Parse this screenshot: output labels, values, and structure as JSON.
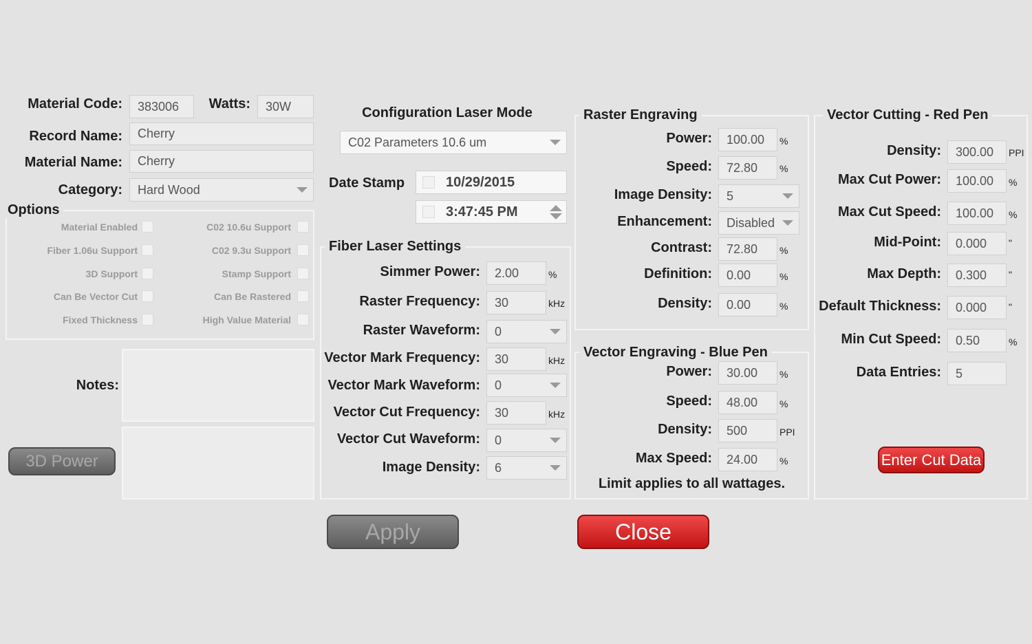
{
  "material": {
    "code_label": "Material Code:",
    "code_value": "383006",
    "watts_label": "Watts:",
    "watts_value": "30W",
    "record_label": "Record Name:",
    "record_value": "Cherry",
    "name_label": "Material Name:",
    "name_value": "Cherry",
    "category_label": "Category:",
    "category_value": "Hard Wood"
  },
  "options": {
    "title": "Options",
    "left": [
      {
        "label": "Material Enabled",
        "checked": false
      },
      {
        "label": "Fiber 1.06u Support",
        "checked": false
      },
      {
        "label": "3D Support",
        "checked": false
      },
      {
        "label": "Can Be Vector Cut",
        "checked": false
      },
      {
        "label": "Fixed Thickness",
        "checked": false
      }
    ],
    "right": [
      {
        "label": "C02 10.6u Support",
        "checked": false
      },
      {
        "label": "C02 9.3u Support",
        "checked": false
      },
      {
        "label": "Stamp Support",
        "checked": false
      },
      {
        "label": "Can Be Rastered",
        "checked": false
      },
      {
        "label": "High Value Material",
        "checked": false
      }
    ]
  },
  "notes": {
    "label": "Notes:"
  },
  "buttons": {
    "power3d": "3D Power",
    "apply": "Apply",
    "close": "Close",
    "enter_cut": "Enter Cut Data"
  },
  "config": {
    "title": "Configuration Laser Mode",
    "mode_value": "C02 Parameters 10.6 um",
    "date_stamp_label": "Date Stamp",
    "date_value": "10/29/2015",
    "time_value": "3:47:45 PM"
  },
  "fiber": {
    "title": "Fiber Laser Settings",
    "rows": [
      {
        "label": "Simmer Power:",
        "value": "2.00",
        "unit": "%"
      },
      {
        "label": "Raster Frequency:",
        "value": "30",
        "unit": "kHz"
      },
      {
        "label": "Raster Waveform:",
        "value": "0",
        "unit": ""
      },
      {
        "label": "Vector Mark Frequency:",
        "value": "30",
        "unit": "kHz"
      },
      {
        "label": "Vector Mark Waveform:",
        "value": "0",
        "unit": ""
      },
      {
        "label": "Vector Cut Frequency:",
        "value": "30",
        "unit": "kHz"
      },
      {
        "label": "Vector Cut Waveform:",
        "value": "0",
        "unit": ""
      },
      {
        "label": "Image Density:",
        "value": "6",
        "unit": ""
      }
    ]
  },
  "raster": {
    "title": "Raster Engraving",
    "rows": [
      {
        "label": "Power:",
        "value": "100.00",
        "unit": "%"
      },
      {
        "label": "Speed:",
        "value": "72.80",
        "unit": "%"
      },
      {
        "label": "Image Density:",
        "value": "5",
        "unit": ""
      },
      {
        "label": "Enhancement:",
        "value": "Disabled",
        "unit": ""
      },
      {
        "label": "Contrast:",
        "value": "72.80",
        "unit": "%"
      },
      {
        "label": "Definition:",
        "value": "0.00",
        "unit": "%"
      },
      {
        "label": "Density:",
        "value": "0.00",
        "unit": "%"
      }
    ]
  },
  "vector_engraving": {
    "title": "Vector Engraving - Blue Pen",
    "rows": [
      {
        "label": "Power:",
        "value": "30.00",
        "unit": "%"
      },
      {
        "label": "Speed:",
        "value": "48.00",
        "unit": "%"
      },
      {
        "label": "Density:",
        "value": "500",
        "unit": "PPI"
      },
      {
        "label": "Max Speed:",
        "value": "24.00",
        "unit": "%"
      }
    ],
    "note": "Limit applies to all wattages."
  },
  "vector_cutting": {
    "title": "Vector Cutting - Red Pen",
    "rows": [
      {
        "label": "Density:",
        "value": "300.00",
        "unit": "PPI"
      },
      {
        "label": "Max Cut Power:",
        "value": "100.00",
        "unit": "%"
      },
      {
        "label": "Max Cut Speed:",
        "value": "100.00",
        "unit": "%"
      },
      {
        "label": "Mid-Point:",
        "value": "0.000",
        "unit": "\""
      },
      {
        "label": "Max Depth:",
        "value": "0.300",
        "unit": "\""
      },
      {
        "label": "Default Thickness:",
        "value": "0.000",
        "unit": "\""
      },
      {
        "label": "Min Cut Speed:",
        "value": "0.50",
        "unit": "%"
      },
      {
        "label": "Data Entries:",
        "value": "5",
        "unit": ""
      }
    ]
  },
  "colors": {
    "background": "#e3e3e3",
    "accent_red": "#d42020",
    "button_gray": "#6b6b6b"
  }
}
